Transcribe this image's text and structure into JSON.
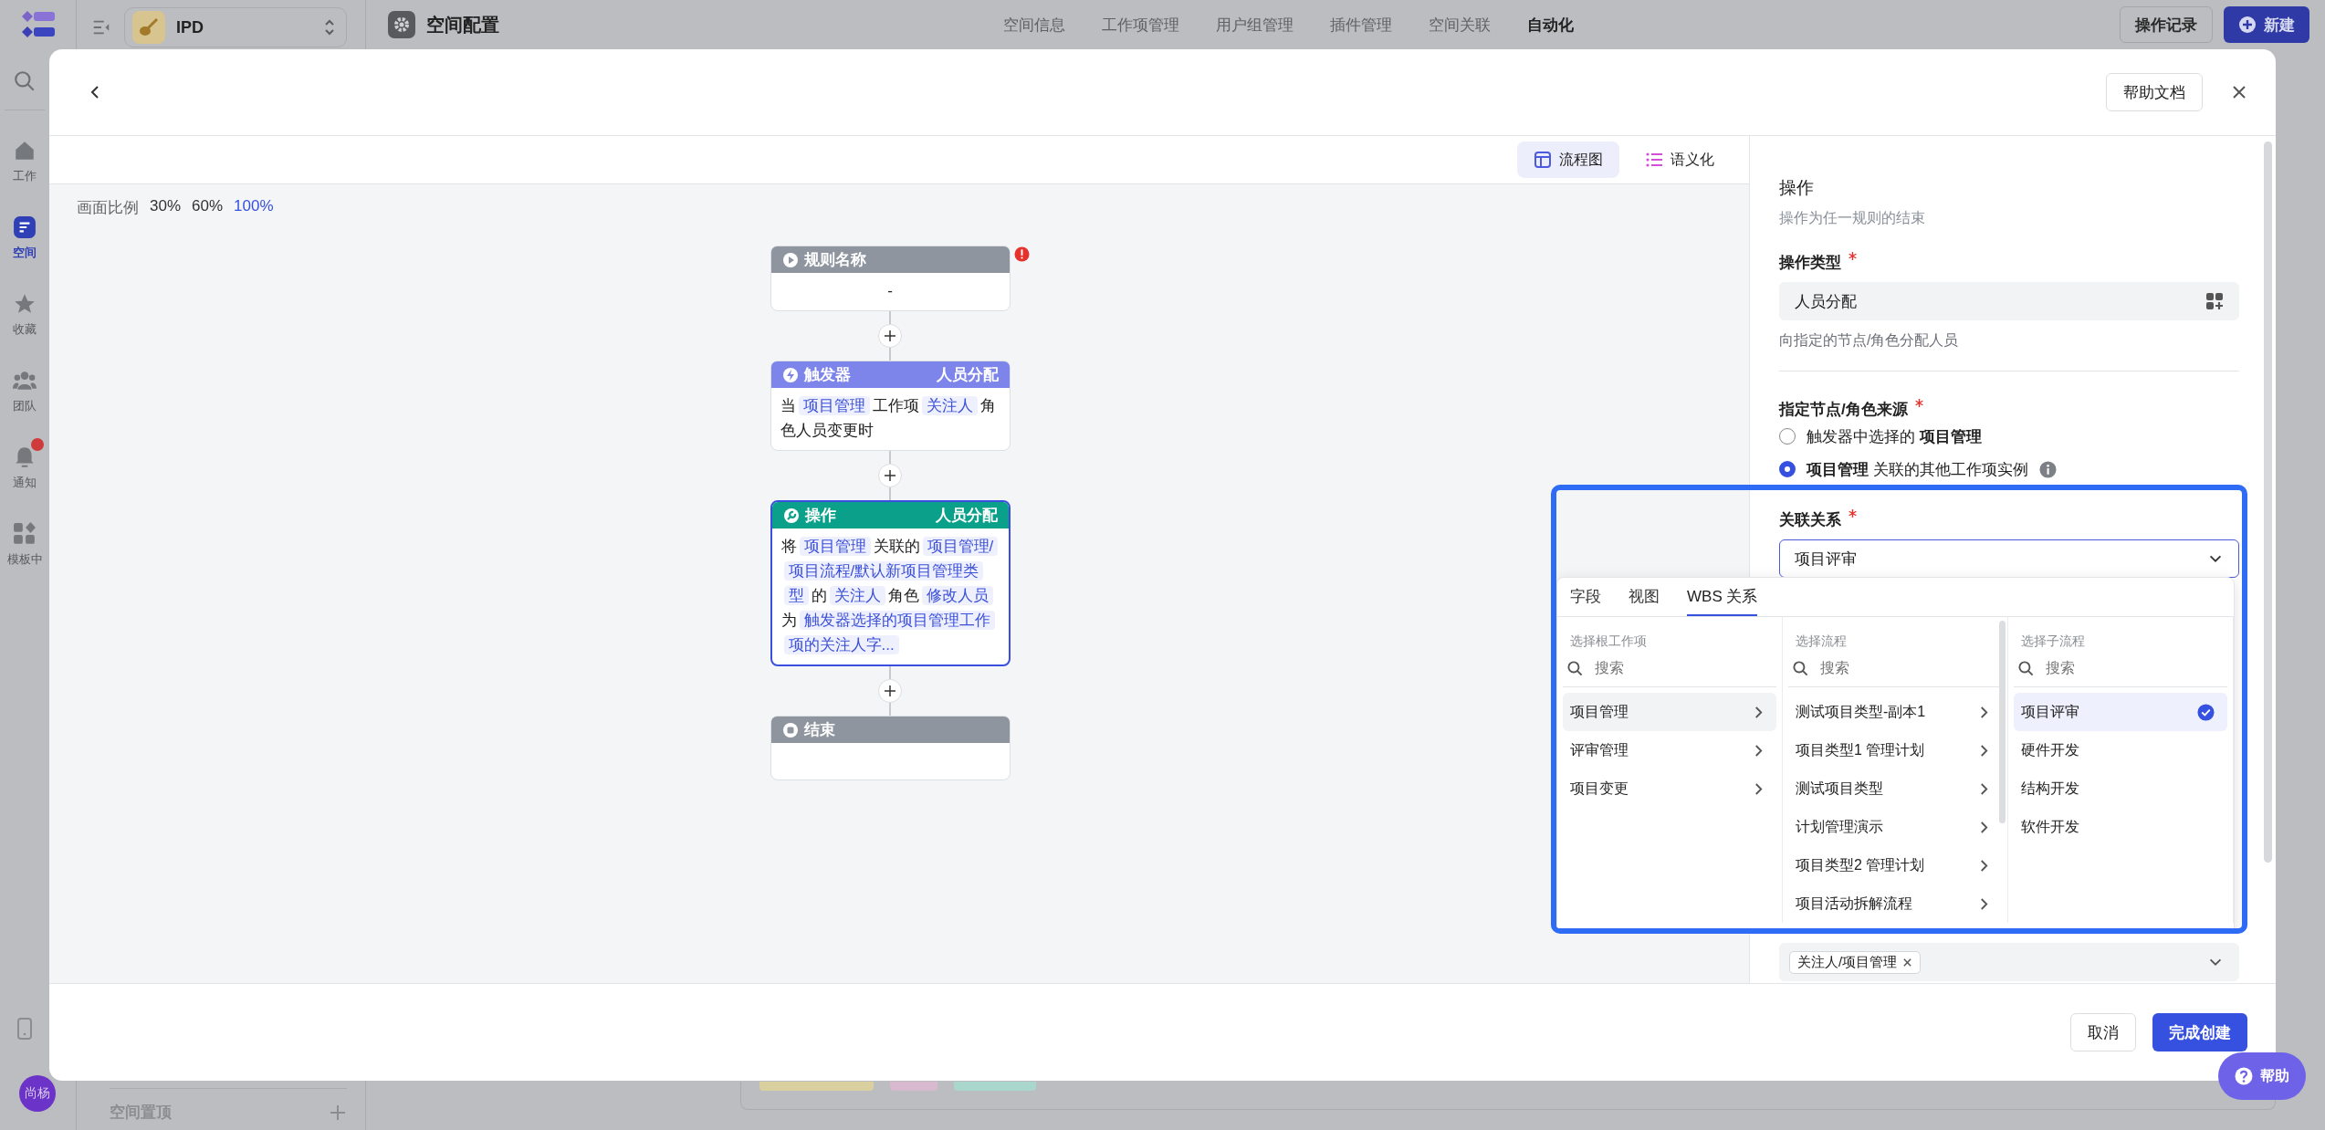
{
  "rail": {
    "items": [
      {
        "kind": "home",
        "label": "工作",
        "selected": false,
        "badge": false
      },
      {
        "kind": "space",
        "label": "空间",
        "selected": true,
        "badge": false
      },
      {
        "kind": "star",
        "label": "收藏",
        "selected": false,
        "badge": false
      },
      {
        "kind": "team",
        "label": "团队",
        "selected": false,
        "badge": false
      },
      {
        "kind": "bell",
        "label": "通知",
        "selected": false,
        "badge": true
      },
      {
        "kind": "grid",
        "label": "模板中",
        "selected": false,
        "badge": false
      }
    ],
    "avatar": "尚杨"
  },
  "sidebar": {
    "space": "IPD",
    "pinned_section": "空间置顶"
  },
  "top_bar": {
    "title": "空间配置",
    "tabs": [
      {
        "label": "空间信息",
        "selected": false
      },
      {
        "label": "工作项管理",
        "selected": false
      },
      {
        "label": "用户组管理",
        "selected": false
      },
      {
        "label": "插件管理",
        "selected": false
      },
      {
        "label": "空间关联",
        "selected": false
      },
      {
        "label": "自动化",
        "selected": true
      }
    ],
    "buttons": [
      {
        "label": "操作记录",
        "kind": "secondary"
      },
      {
        "label": "新建",
        "kind": "primary"
      }
    ]
  },
  "modal": {
    "help_doc": "帮助文档",
    "view_tabs": [
      {
        "kind": "flow",
        "label": "流程图",
        "selected": true
      },
      {
        "kind": "list",
        "label": "语义化",
        "selected": false
      }
    ],
    "zoom": {
      "label": "画面比例",
      "options": [
        {
          "label": "30%",
          "selected": false
        },
        {
          "label": "60%",
          "selected": false
        },
        {
          "label": "100%",
          "selected": true
        }
      ]
    },
    "nodes": [
      {
        "kind": "start",
        "title": "规则名称",
        "error": true,
        "selected": false,
        "body": [
          {
            "text": "-",
            "chip": false
          }
        ]
      },
      {
        "kind": "trigger",
        "title": "触发器",
        "tag": "人员分配",
        "error": false,
        "selected": false,
        "body": [
          {
            "text": "当",
            "chip": false
          },
          {
            "text": "项目管理",
            "chip": true
          },
          {
            "text": "工作项",
            "chip": false
          },
          {
            "text": "关注人",
            "chip": true
          },
          {
            "text": "角色人员变更时",
            "chip": false
          }
        ]
      },
      {
        "kind": "action",
        "title": "操作",
        "tag": "人员分配",
        "error": false,
        "selected": true,
        "body": [
          {
            "text": "将",
            "chip": false
          },
          {
            "text": "项目管理",
            "chip": true
          },
          {
            "text": "关联的",
            "chip": false
          },
          {
            "text": "项目管理/项目流程/默认新项目管理类型",
            "chip": true
          },
          {
            "text": "的",
            "chip": false
          },
          {
            "text": "关注人",
            "chip": true
          },
          {
            "text": "角色",
            "chip": false
          },
          {
            "text": "修改人员",
            "chip": true
          },
          {
            "text": "为",
            "chip": false
          },
          {
            "text": "触发器选择的项目管理工作项的关注人字...",
            "chip": true
          }
        ]
      },
      {
        "kind": "end",
        "title": "结束",
        "error": false,
        "selected": false
      }
    ],
    "panel": {
      "title": "操作",
      "subtitle": "操作为任一规则的结束",
      "action_type": {
        "label": "操作类型",
        "required": true,
        "value": "人员分配",
        "hint": "向指定的节点/角色分配人员"
      },
      "source": {
        "label": "指定节点/角色来源",
        "required": true,
        "options": [
          {
            "text": "触发器中选择的 **项目管理**",
            "selected": false,
            "info": false
          },
          {
            "text": "**项目管理** 关联的其他工作项实例",
            "selected": true,
            "info": true
          }
        ]
      },
      "relation": {
        "label": "关联关系",
        "required": true,
        "value": "项目评审",
        "focused": true
      },
      "assignees": {
        "tags": [
          "关注人/项目管理"
        ]
      }
    },
    "dropdown": {
      "tabs": [
        {
          "label": "字段",
          "selected": false
        },
        {
          "label": "视图",
          "selected": false
        },
        {
          "label": "WBS 关系",
          "selected": true
        }
      ],
      "columns": [
        {
          "title": "选择根工作项",
          "placeholder": "搜索",
          "items": [
            {
              "label": "项目管理",
              "selected": true,
              "has_children": true
            },
            {
              "label": "评审管理",
              "selected": false,
              "has_children": true
            },
            {
              "label": "项目变更",
              "selected": false,
              "has_children": true
            }
          ]
        },
        {
          "title": "选择流程",
          "placeholder": "搜索",
          "items": [
            {
              "label": "测试项目类型-副本1",
              "selected": false,
              "has_children": true
            },
            {
              "label": "项目类型1 管理计划",
              "selected": false,
              "has_children": true
            },
            {
              "label": "测试项目类型",
              "selected": false,
              "has_children": true
            },
            {
              "label": "计划管理演示",
              "selected": false,
              "has_children": true
            },
            {
              "label": "项目类型2 管理计划",
              "selected": false,
              "has_children": true
            },
            {
              "label": "项目活动拆解流程",
              "selected": false,
              "has_children": true
            }
          ]
        },
        {
          "title": "选择子流程",
          "placeholder": "搜索",
          "items": [
            {
              "label": "项目评审",
              "selected": true,
              "has_children": false
            },
            {
              "label": "硬件开发",
              "selected": false,
              "has_children": false
            },
            {
              "label": "结构开发",
              "selected": false,
              "has_children": false
            },
            {
              "label": "软件开发",
              "selected": false,
              "has_children": false
            }
          ]
        }
      ]
    },
    "footer": {
      "buttons": [
        {
          "label": "取消",
          "kind": "secondary"
        },
        {
          "label": "完成创建",
          "kind": "primary"
        }
      ]
    }
  },
  "help_button": "帮助"
}
